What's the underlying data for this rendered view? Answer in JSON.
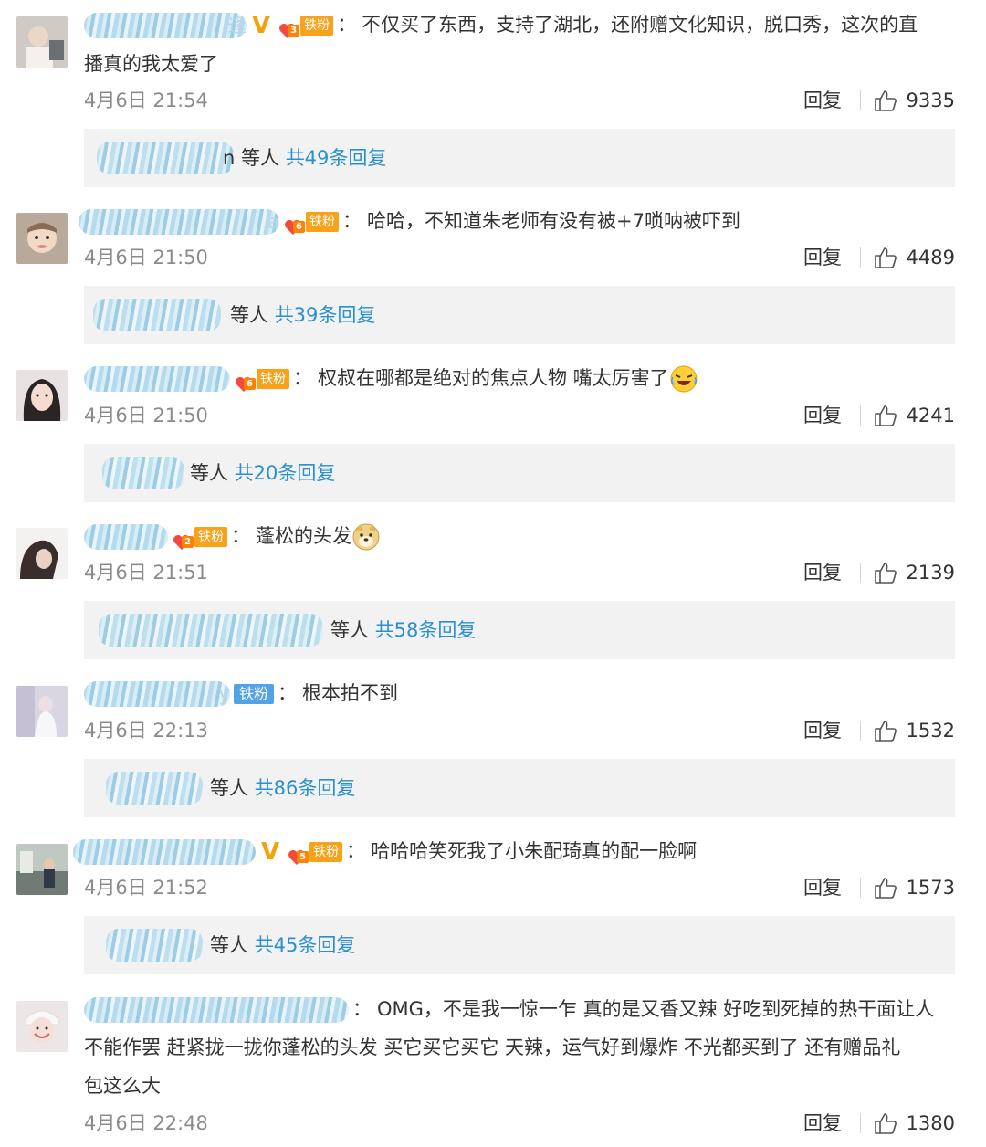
{
  "colors": {
    "verified": "#f2a20b",
    "fan_badge": "#f7a21a",
    "fan_badge_blue": "#52a3e6",
    "link": "#2a8fd1",
    "muted": "#8b8b8b",
    "reply_bg": "#f2f2f2"
  },
  "ui": {
    "reply_label": "回复",
    "like_icon": "thumbs-up-icon",
    "fan_badge": "铁粉",
    "colon": "："
  },
  "comments": [
    {
      "user_suffix": "逢",
      "verified": true,
      "fan_level": "3",
      "text_line1": "不仅买了东西，支持了湖北，还附赠文化知识，脱口秀，这次的直",
      "text_line2": "播真的我太爱了",
      "time": "4月6日 21:54",
      "likes": "9335",
      "replies_prefix": "n 等人",
      "replies_total": "共49条回复"
    },
    {
      "user_suffix": "a",
      "verified": false,
      "fan_level": "6",
      "text_line1": "哈哈，不知道朱老师有没有被+7唢呐被吓到",
      "time": "4月6日 21:50",
      "likes": "4489",
      "replies_prefix": "等人",
      "replies_total": "共39条回复"
    },
    {
      "user_suffix": "",
      "verified": false,
      "fan_level": "6",
      "text_line1": "权叔在哪都是绝对的焦点人物 嘴太厉害了",
      "emoji": "laughing-crying-emoji",
      "time": "4月6日 21:50",
      "likes": "4241",
      "replies_prefix": "等人",
      "replies_total": "共20条回复"
    },
    {
      "user_suffix": "",
      "verified": false,
      "fan_level": "2",
      "text_line1": "蓬松的头发",
      "emoji": "doge-emoji",
      "time": "4月6日 21:51",
      "likes": "2139",
      "replies_prefix": "等人",
      "replies_total": "共58条回复"
    },
    {
      "user_suffix": "y",
      "verified": false,
      "fan_level": "",
      "text_line1": "根本拍不到",
      "time": "4月6日 22:13",
      "likes": "1532",
      "replies_prefix": "等人",
      "replies_total": "共86条回复"
    },
    {
      "user_suffix": "",
      "verified": true,
      "fan_level": "5",
      "text_line1": "哈哈哈笑死我了小朱配琦真的配一脸啊",
      "time": "4月6日 21:52",
      "likes": "1573",
      "replies_prefix": "等人",
      "replies_total": "共45条回复"
    },
    {
      "user_suffix": "",
      "verified": false,
      "fan_level": "",
      "text_line1": "OMG，不是我一惊一乍 真的是又香又辣 好吃到死掉的热干面让人",
      "text_line2": "不能作罢 赶紧拢一拢你蓬松的头发 买它买它买它 天辣，运气好到爆炸 不光都买到了 还有赠品礼",
      "text_line3": "包这么大",
      "time": "4月6日 22:48",
      "likes": "1380"
    }
  ]
}
